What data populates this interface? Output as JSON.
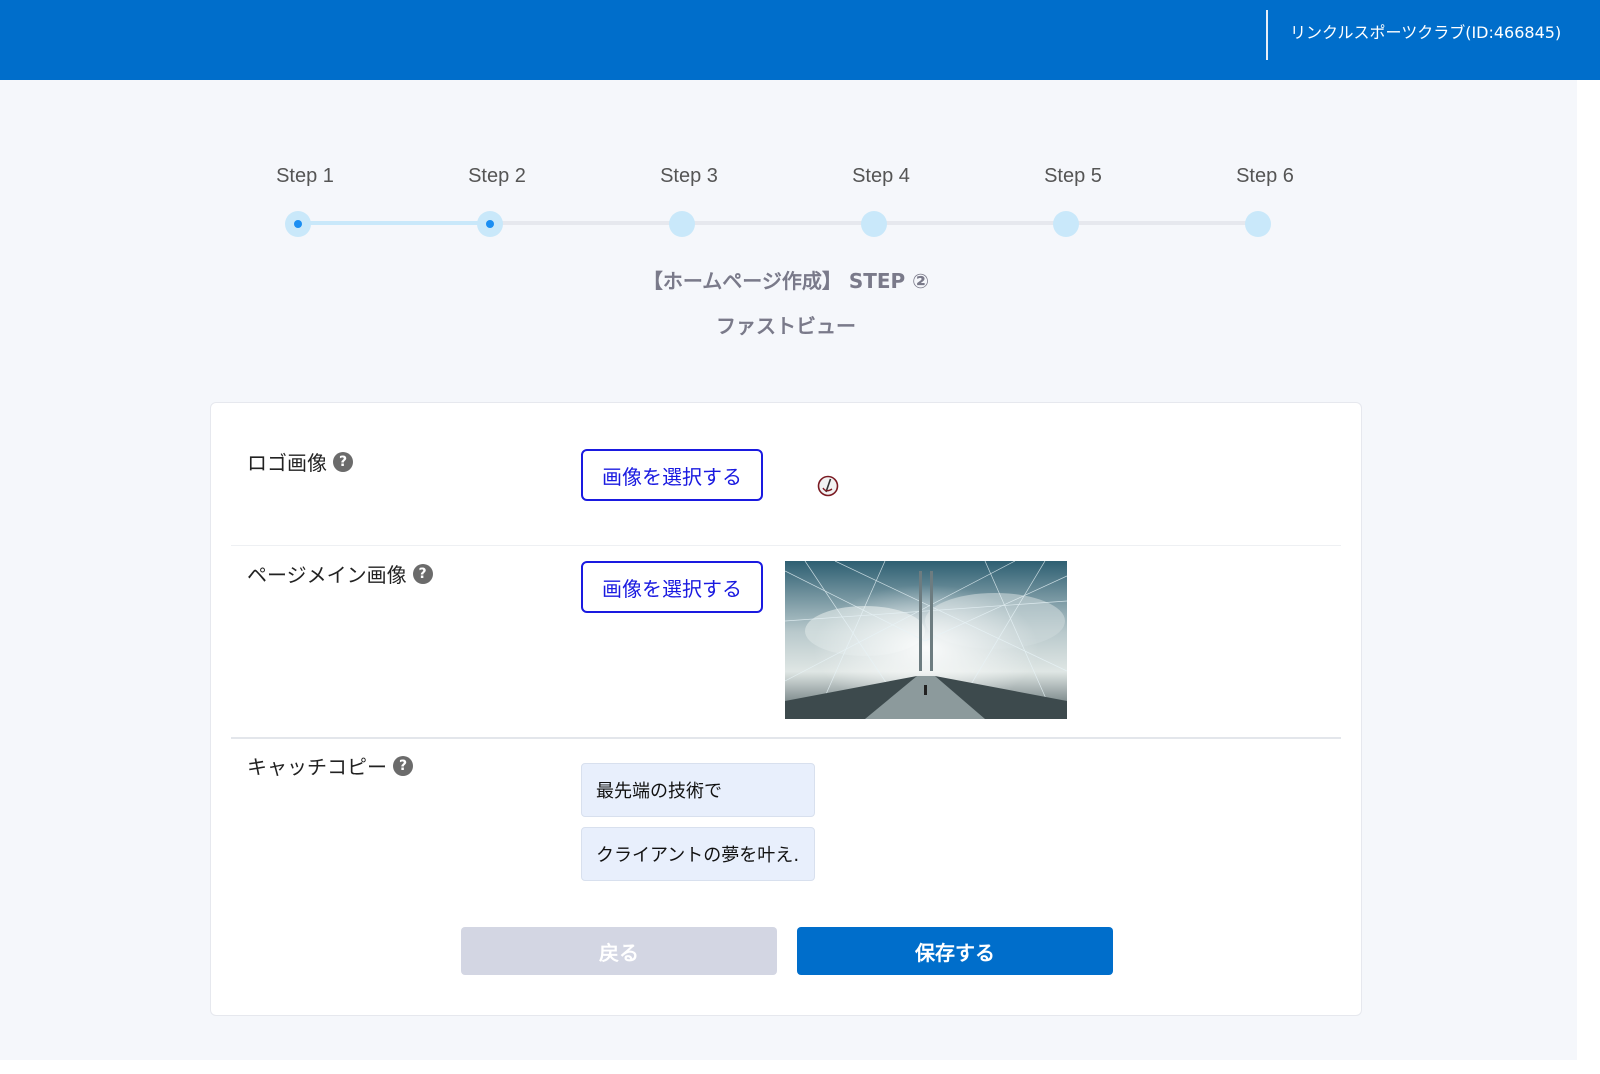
{
  "header": {
    "account_name": "リンクルスポーツクラブ(ID:466845)"
  },
  "stepper": {
    "steps": [
      {
        "label": "Step 1",
        "state": "done"
      },
      {
        "label": "Step 2",
        "state": "current"
      },
      {
        "label": "Step 3",
        "state": "todo"
      },
      {
        "label": "Step 4",
        "state": "todo"
      },
      {
        "label": "Step 5",
        "state": "todo"
      },
      {
        "label": "Step 6",
        "state": "todo"
      }
    ],
    "title": "【ホームページ作成】 STEP ②",
    "subtitle": "ファストビュー"
  },
  "form": {
    "logo_label": "ロゴ画像",
    "main_image_label": "ページメイン画像",
    "catchcopy_label": "キャッチコピー",
    "select_image_label": "画像を選択する",
    "help_icon_glyph": "?",
    "catchcopy_line1": "最先端の技術で",
    "catchcopy_line2": "クライアントの夢を叶え…"
  },
  "actions": {
    "back_label": "戻る",
    "save_label": "保存する"
  },
  "colors": {
    "brand": "#006ecb",
    "select_button": "#1a1ae0",
    "step_done": "#c9e8fa",
    "step_dot": "#1b8ef2"
  }
}
